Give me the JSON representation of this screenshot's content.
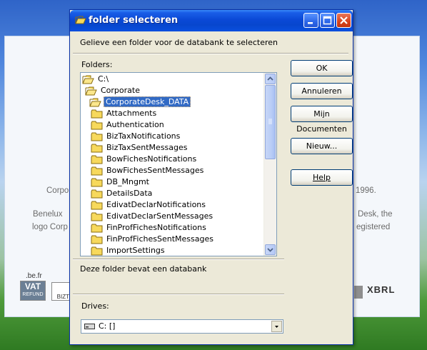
{
  "background": {
    "line1_left": "Corpo",
    "line1_right": "1996.",
    "line2_left": "Benelux",
    "line2_right": "Desk, the",
    "line3_left": "logo Corp",
    "line3_right": "egistered",
    "logo_befr": ".be.fr",
    "logo_vat": "VAT",
    "logo_refund": "REFUND",
    "logo_biz": "BIZT",
    "logo_xbrl": "XBRL"
  },
  "dialog": {
    "title": "folder selecteren",
    "instruction": "Gelieve een folder voor de databank te selecteren",
    "folders_label": "Folders:",
    "tree": [
      {
        "label": "C:\\",
        "state": "open",
        "level": 0
      },
      {
        "label": "Corporate",
        "state": "open",
        "level": 1
      },
      {
        "label": "CorporateDesk_DATA",
        "state": "open-selected",
        "level": 2
      },
      {
        "label": "Attachments",
        "state": "closed",
        "level": 3
      },
      {
        "label": "Authentication",
        "state": "closed",
        "level": 3
      },
      {
        "label": "BizTaxNotifications",
        "state": "closed",
        "level": 3
      },
      {
        "label": "BizTaxSentMessages",
        "state": "closed",
        "level": 3
      },
      {
        "label": "BowFichesNotifications",
        "state": "closed",
        "level": 3
      },
      {
        "label": "BowFichesSentMessages",
        "state": "closed",
        "level": 3
      },
      {
        "label": "DB_Mngmt",
        "state": "closed",
        "level": 3
      },
      {
        "label": "DetailsData",
        "state": "closed",
        "level": 3
      },
      {
        "label": "EdivatDeclarNotifications",
        "state": "closed",
        "level": 3
      },
      {
        "label": "EdivatDeclarSentMessages",
        "state": "closed",
        "level": 3
      },
      {
        "label": "FinProfFichesNotifications",
        "state": "closed",
        "level": 3
      },
      {
        "label": "FinProfFichesSentMessages",
        "state": "closed",
        "level": 3
      },
      {
        "label": "ImportSettings",
        "state": "closed",
        "level": 3
      }
    ],
    "status_text": "Deze folder bevat een databank",
    "drives_label": "Drives:",
    "drive_value": "C: []",
    "buttons": {
      "ok": "OK",
      "cancel": "Annuleren",
      "my_documents": "Mijn Documenten",
      "new": "Nieuw...",
      "help": "Help"
    },
    "colors": {
      "titlebar": "#0a49d6",
      "selection": "#316ac5",
      "dialog_bg": "#ece9d8",
      "folder_yellow": "#f7d95c"
    },
    "icons": [
      "folder-open-icon",
      "folder-icon",
      "minimize-icon",
      "maximize-icon",
      "close-icon",
      "drive-icon",
      "chevron-down-icon"
    ]
  }
}
